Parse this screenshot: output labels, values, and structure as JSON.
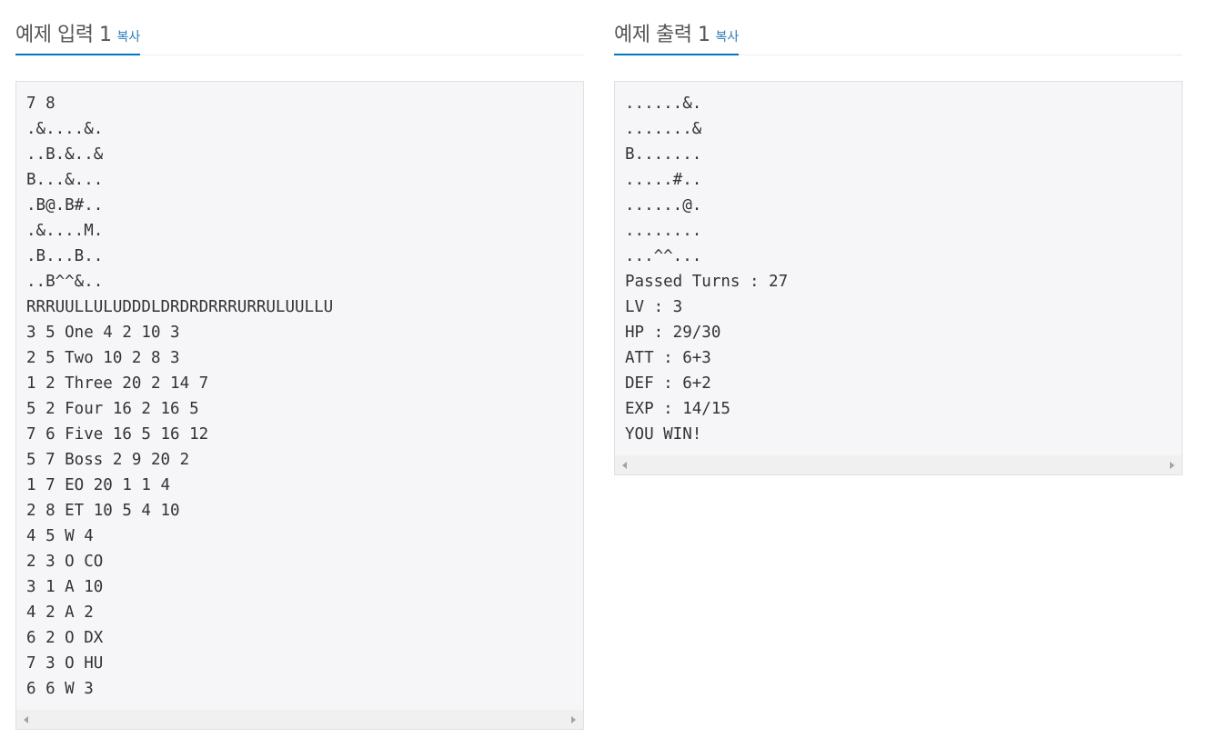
{
  "input_panel": {
    "title": "예제 입력 1",
    "copy_label": "복사",
    "lines": [
      "7 8",
      ".&....&.",
      "..B.&..&",
      "B...&...",
      ".B@.B#..",
      ".&....M.",
      ".B...B..",
      "..B^^&..",
      "RRRUULLULUDDDLDRDRDRRRURRULUULLU",
      "3 5 One 4 2 10 3",
      "2 5 Two 10 2 8 3",
      "1 2 Three 20 2 14 7",
      "5 2 Four 16 2 16 5",
      "7 6 Five 16 5 16 12",
      "5 7 Boss 2 9 20 2",
      "1 7 EO 20 1 1 4",
      "2 8 ET 10 5 4 10",
      "4 5 W 4",
      "2 3 O CO",
      "3 1 A 10",
      "4 2 A 2",
      "6 2 O DX",
      "7 3 O HU",
      "6 6 W 3"
    ]
  },
  "output_panel": {
    "title": "예제 출력 1",
    "copy_label": "복사",
    "lines": [
      "......&.",
      ".......&",
      "B.......",
      ".....#..",
      "......@.",
      "........",
      "...^^...",
      "Passed Turns : 27",
      "LV : 3",
      "HP : 29/30",
      "ATT : 6+3",
      "DEF : 6+2",
      "EXP : 14/15",
      "YOU WIN!"
    ]
  },
  "colors": {
    "accent": "#0076c0",
    "link": "#2b7bb9",
    "box_bg": "#f6f6f8",
    "box_border": "#e0e0e0",
    "title_text": "#555555"
  },
  "icons": {
    "scroll_left": "scroll-left-arrow-icon",
    "scroll_right": "scroll-right-arrow-icon"
  }
}
